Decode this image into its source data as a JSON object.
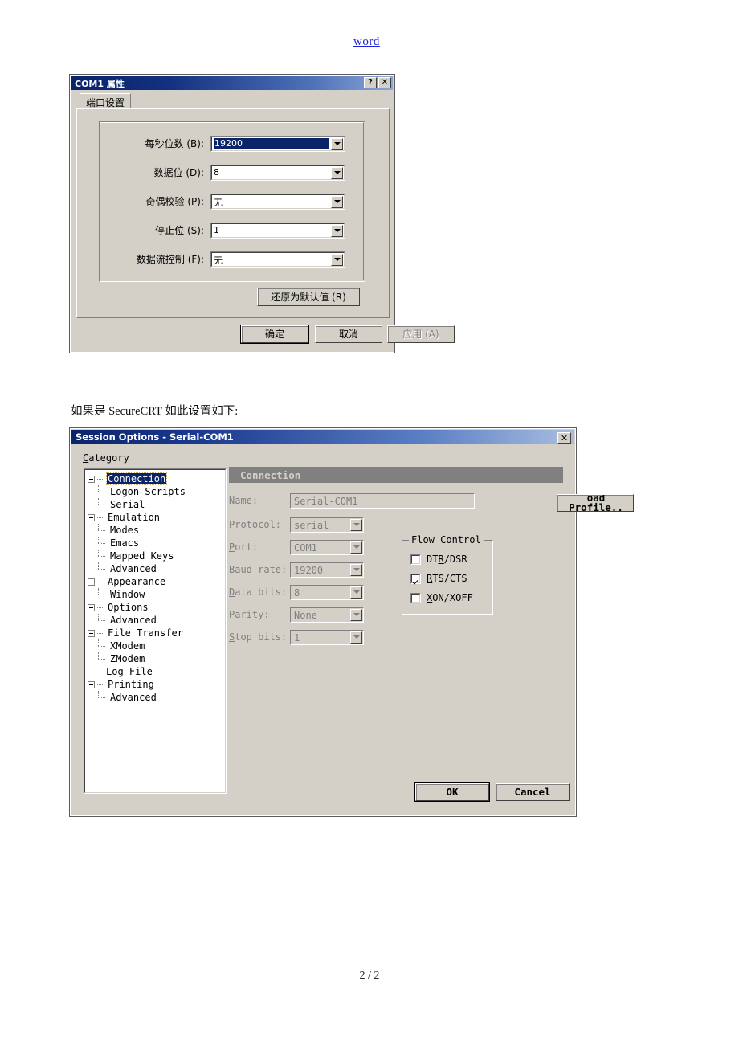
{
  "page": {
    "link_text": "word",
    "paragraph": "如果是 SecureCRT 如此设置如下:",
    "footer": "2 / 2"
  },
  "com_dialog": {
    "title": "COM1 属性",
    "help_button": "?",
    "close_button": "✕",
    "tab": "端口设置",
    "fields": [
      {
        "label": "每秒位数 (B):",
        "value": "19200",
        "selected": true
      },
      {
        "label": "数据位 (D):",
        "value": "8",
        "selected": false
      },
      {
        "label": "奇偶校验 (P):",
        "value": "无",
        "selected": false
      },
      {
        "label": "停止位 (S):",
        "value": "1",
        "selected": false
      },
      {
        "label": "数据流控制 (F):",
        "value": "无",
        "selected": false
      }
    ],
    "restore_button": "还原为默认值 (R)",
    "ok_button": "确定",
    "cancel_button": "取消",
    "apply_button": "应用 (A)"
  },
  "session_dialog": {
    "title": "Session Options - Serial-COM1",
    "close_button": "✕",
    "category_label": "Category",
    "tree": [
      {
        "label": "Connection",
        "level": 0,
        "expander": true,
        "selected": true
      },
      {
        "label": "Logon Scripts",
        "level": 1,
        "expander": false,
        "selected": false
      },
      {
        "label": "Serial",
        "level": 1,
        "expander": false,
        "selected": false
      },
      {
        "label": "Emulation",
        "level": 0,
        "expander": true,
        "selected": false
      },
      {
        "label": "Modes",
        "level": 1,
        "expander": false,
        "selected": false
      },
      {
        "label": "Emacs",
        "level": 1,
        "expander": false,
        "selected": false
      },
      {
        "label": "Mapped Keys",
        "level": 1,
        "expander": false,
        "selected": false
      },
      {
        "label": "Advanced",
        "level": 1,
        "expander": false,
        "selected": false
      },
      {
        "label": "Appearance",
        "level": 0,
        "expander": true,
        "selected": false
      },
      {
        "label": "Window",
        "level": 1,
        "expander": false,
        "selected": false
      },
      {
        "label": "Options",
        "level": 0,
        "expander": true,
        "selected": false
      },
      {
        "label": "Advanced",
        "level": 1,
        "expander": false,
        "selected": false
      },
      {
        "label": "File Transfer",
        "level": 0,
        "expander": true,
        "selected": false
      },
      {
        "label": "XModem",
        "level": 1,
        "expander": false,
        "selected": false
      },
      {
        "label": "ZModem",
        "level": 1,
        "expander": false,
        "selected": false
      },
      {
        "label": "Log File",
        "level": 0,
        "expander": false,
        "selected": false
      },
      {
        "label": "Printing",
        "level": 0,
        "expander": true,
        "selected": false
      },
      {
        "label": "Advanced",
        "level": 1,
        "expander": false,
        "selected": false
      }
    ],
    "panel_title": "Connection",
    "fields": {
      "name_label": "Name:",
      "name_value": "Serial-COM1",
      "protocol_label": "Protocol:",
      "protocol_value": "serial",
      "port_label": "Port:",
      "port_value": "COM1",
      "baud_label": "Baud rate:",
      "baud_value": "19200",
      "databits_label": "Data bits:",
      "databits_value": "8",
      "parity_label": "Parity:",
      "parity_value": "None",
      "stopbits_label": "Stop bits:",
      "stopbits_value": "1"
    },
    "load_profile_button": "oad Profile..",
    "flow_control": {
      "legend": "Flow Control",
      "items": [
        {
          "label": "DTR/DSR",
          "checked": false
        },
        {
          "label": "RTS/CTS",
          "checked": true
        },
        {
          "label": "XON/XOFF",
          "checked": false
        }
      ]
    },
    "ok_button": "OK",
    "cancel_button": "Cancel"
  },
  "colors": {
    "dialog_face": "#d4d0c8",
    "titlebar_start": "#0a246a",
    "titlebar_end": "#a8bde0",
    "selection": "#0a246a",
    "disabled_text": "#808080",
    "link": "#2222dd",
    "panel_header": "#808080"
  }
}
